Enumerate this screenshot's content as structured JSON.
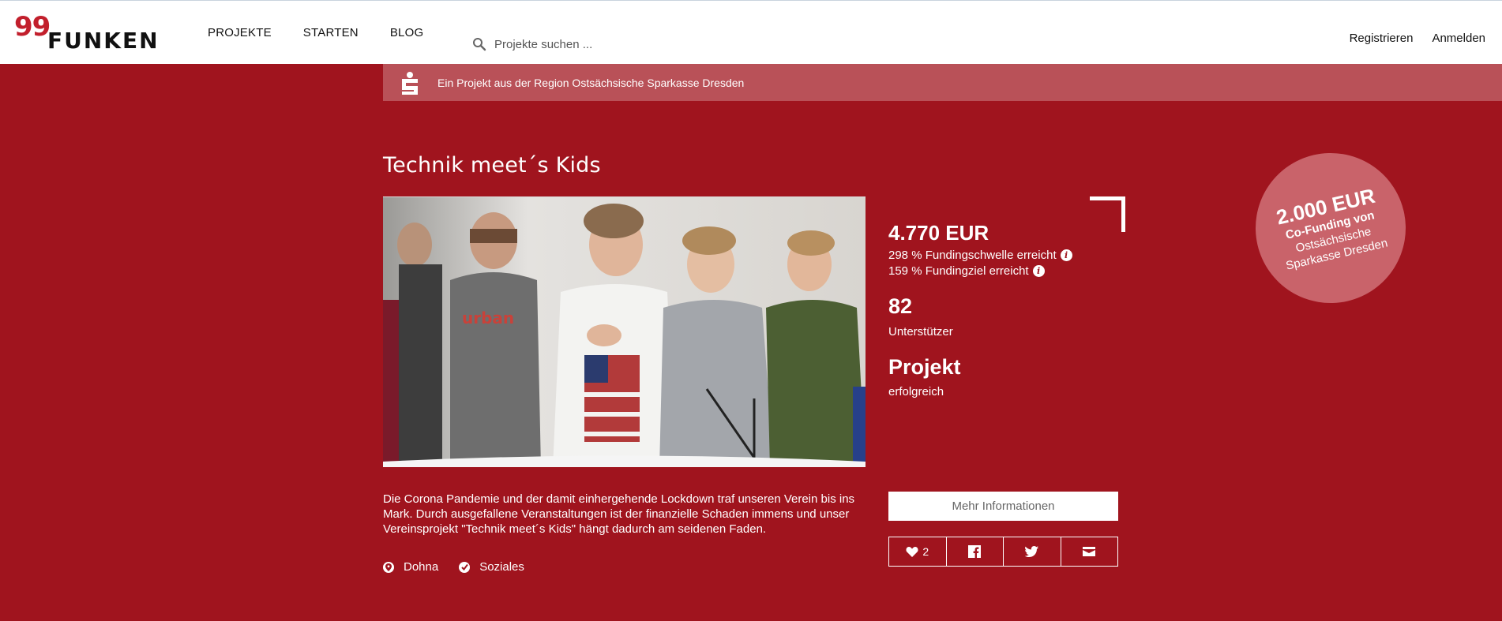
{
  "header": {
    "logo_number": "99",
    "logo_word": "FUNKEN",
    "nav": [
      "PROJEKTE",
      "STARTEN",
      "BLOG"
    ],
    "search_placeholder": "Projekte suchen ...",
    "register": "Registrieren",
    "login": "Anmelden"
  },
  "region": {
    "text": "Ein Projekt aus der Region Ostsächsische Sparkasse Dresden"
  },
  "project": {
    "title": "Technik meet´s Kids",
    "amount": "4.770 EUR",
    "threshold": "298 % Fundingschwelle erreicht",
    "goal": "159 % Fundingziel erreicht",
    "supporters_count": "82",
    "supporters_label": "Unterstützer",
    "status_title": "Projekt",
    "status_label": "erfolgreich",
    "description": "Die Corona Pandemie und der damit einhergehende Lockdown traf unseren Verein bis ins Mark. Durch ausgefallene Veranstaltungen ist der finanzielle Schaden immens und unser Vereinsprojekt \"Technik meet´s Kids\" hängt dadurch am seidenen Faden.",
    "location": "Dohna",
    "category": "Soziales",
    "more_info": "Mehr Informationen",
    "likes": "2"
  },
  "cofunding": {
    "amount": "2.000 EUR",
    "line1": "Co-Funding von",
    "line2": "Ostsächsische",
    "line3": "Sparkasse Dresden"
  },
  "colors": {
    "brand_red": "#a0141e",
    "logo_red": "#c21f2c",
    "region_bar": "#b95158",
    "cofund_circle": "#c9636a"
  },
  "icons": {
    "search": "search-icon",
    "sparkasse": "sparkasse-logo-icon",
    "info": "info-icon",
    "location": "map-pin-icon",
    "category": "check-icon",
    "heart": "heart-icon",
    "facebook": "facebook-icon",
    "twitter": "twitter-icon",
    "mail": "mail-icon"
  }
}
